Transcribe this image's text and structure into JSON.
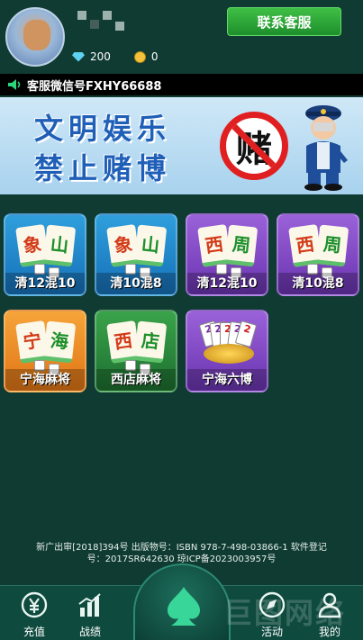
{
  "header": {
    "diamonds": "200",
    "coins": "0",
    "contact_button": "联系客服"
  },
  "notice": {
    "text": "客服微信号FXHY66688"
  },
  "banner": {
    "line1": "文明娱乐",
    "line2": "禁止赌博",
    "sign_char": "赌"
  },
  "games": [
    {
      "label": "清12混10",
      "tile_a": "象",
      "tile_b": "山",
      "theme": "blue"
    },
    {
      "label": "清10混8",
      "tile_a": "象",
      "tile_b": "山",
      "theme": "blue"
    },
    {
      "label": "清12混10",
      "tile_a": "西",
      "tile_b": "周",
      "theme": "purple"
    },
    {
      "label": "清10混8",
      "tile_a": "西",
      "tile_b": "周",
      "theme": "purple"
    },
    {
      "label": "宁海麻将",
      "tile_a": "宁",
      "tile_b": "海",
      "theme": "orange"
    },
    {
      "label": "西店麻将",
      "tile_a": "西",
      "tile_b": "店",
      "theme": "green"
    },
    {
      "label": "宁海六博",
      "cards": [
        "2",
        "2",
        "2",
        "2",
        "2"
      ],
      "theme": "purple"
    }
  ],
  "footer": {
    "line1": "新广出审[2018]394号 出版物号：ISBN 978-7-498-03866-1 软件登记",
    "line2": "号：2017SR642630 琼ICP备2023003957号"
  },
  "nav": {
    "recharge": "充值",
    "record": "战绩",
    "activity": "活动",
    "mine": "我的"
  },
  "watermark": "巨图网络",
  "colors": {
    "background": "#0f3b33",
    "contact_green": "#2aa83a",
    "banner_text": "#1f5fb8"
  }
}
